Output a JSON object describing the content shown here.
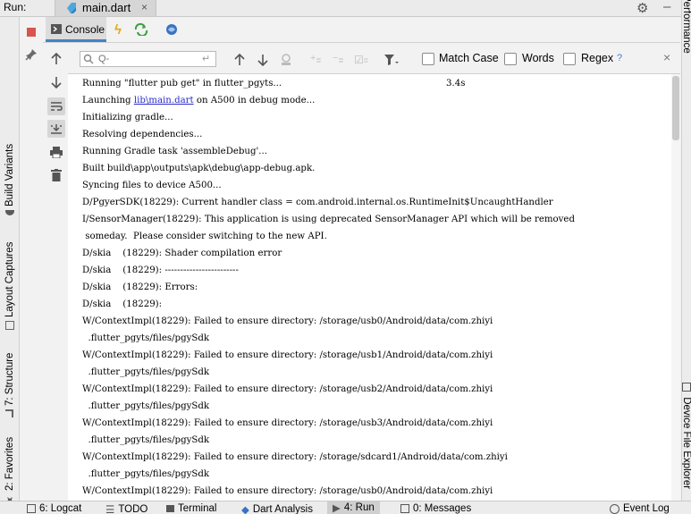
{
  "run": {
    "label": "Run:",
    "tab_name": "main.dart",
    "close": "×"
  },
  "console_tab": {
    "label": "Console"
  },
  "search": {
    "placeholder": "Q-",
    "match_case": "Match Case",
    "words": "Words",
    "regex": "Regex",
    "help": "?",
    "close": "×"
  },
  "left_tabs": [
    "Build Variants",
    "Layout Captures",
    "7: Structure",
    "2: Favorites"
  ],
  "right_tabs": [
    "Performance",
    "Device File Explorer"
  ],
  "bottom_tabs": [
    "6: Logcat",
    "TODO",
    "Terminal",
    "Dart Analysis",
    "4: Run",
    "0: Messages",
    "Event Log"
  ],
  "timing": "3.4s",
  "output_lines": [
    "Running \"flutter pub get\" in flutter_pgyts...",
    "Launching ",
    "Initializing gradle...",
    "Resolving dependencies...",
    "Running Gradle task 'assembleDebug'...",
    "Built build\\app\\outputs\\apk\\debug\\app-debug.apk.",
    "Syncing files to device A500...",
    "D/PgyerSDK(18229): Current handler class = com.android.internal.os.RuntimeInit$UncaughtHandler",
    "I/SensorManager(18229): This application is using deprecated SensorManager API which will be removed",
    " someday.  Please consider switching to the new API.",
    "D/skia    (18229): Shader compilation error",
    "D/skia    (18229): ------------------------",
    "D/skia    (18229): Errors:",
    "D/skia    (18229):",
    "W/ContextImpl(18229): Failed to ensure directory: /storage/usb0/Android/data/com.zhiyi",
    "  .flutter_pgyts/files/pgySdk",
    "W/ContextImpl(18229): Failed to ensure directory: /storage/usb1/Android/data/com.zhiyi",
    "  .flutter_pgyts/files/pgySdk",
    "W/ContextImpl(18229): Failed to ensure directory: /storage/usb2/Android/data/com.zhiyi",
    "  .flutter_pgyts/files/pgySdk",
    "W/ContextImpl(18229): Failed to ensure directory: /storage/usb3/Android/data/com.zhiyi",
    "  .flutter_pgyts/files/pgySdk",
    "W/ContextImpl(18229): Failed to ensure directory: /storage/sdcard1/Android/data/com.zhiyi",
    "  .flutter_pgyts/files/pgySdk",
    "W/ContextImpl(18229): Failed to ensure directory: /storage/usb0/Android/data/com.zhiyi"
  ],
  "launch_link": "lib\\main.dart",
  "launch_suffix": " on A500 in debug mode...",
  "colors": {
    "accent": "#4083c9",
    "link": "#2a2acb",
    "stop": "#d9534f",
    "flash": "#e6a817",
    "reload": "#3c9f3c"
  }
}
